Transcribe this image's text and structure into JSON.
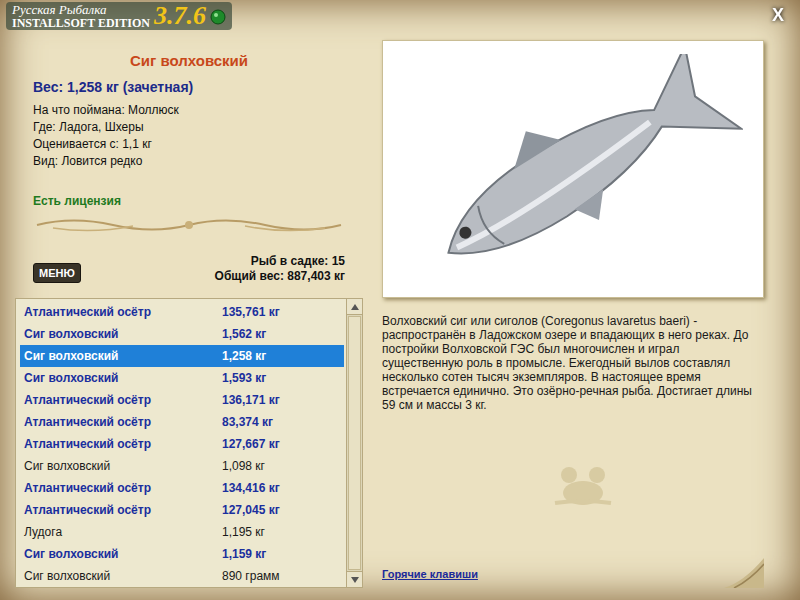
{
  "window": {
    "logo_title": "Русская Рыбалка",
    "logo_edition": "INSTALLSOFT EDITION",
    "logo_version": "3.7.6",
    "close": "X"
  },
  "fish": {
    "name": "Сиг волховский",
    "weight": "Вес: 1,258 кг (зачетная)",
    "details": [
      "На что поймана: Моллюск",
      "Где: Ладога, Шхеры",
      "Оценивается с: 1,1 кг",
      "Вид: Ловится редко"
    ],
    "license": "Есть лицензия"
  },
  "cage": {
    "count": "Рыб в садке: 15",
    "total": "Общий вес: 887,403 кг"
  },
  "menu_button": "МЕНЮ",
  "catch_list": [
    {
      "name": "Атлантический осётр",
      "weight": "135,761 кг",
      "counted": true,
      "selected": false
    },
    {
      "name": "Сиг волховский",
      "weight": "1,562 кг",
      "counted": true,
      "selected": false
    },
    {
      "name": "Сиг волховский",
      "weight": "1,258 кг",
      "counted": true,
      "selected": true
    },
    {
      "name": "Сиг волховский",
      "weight": "1,593 кг",
      "counted": true,
      "selected": false
    },
    {
      "name": "Атлантический осётр",
      "weight": "136,171 кг",
      "counted": true,
      "selected": false
    },
    {
      "name": "Атлантический осётр",
      "weight": "83,374 кг",
      "counted": true,
      "selected": false
    },
    {
      "name": "Атлантический осётр",
      "weight": "127,667 кг",
      "counted": true,
      "selected": false
    },
    {
      "name": "Сиг волховский",
      "weight": "1,098 кг",
      "counted": false,
      "selected": false
    },
    {
      "name": "Атлантический осётр",
      "weight": "134,416 кг",
      "counted": true,
      "selected": false
    },
    {
      "name": "Атлантический осётр",
      "weight": "127,045 кг",
      "counted": true,
      "selected": false
    },
    {
      "name": "Лудога",
      "weight": "1,195 кг",
      "counted": false,
      "selected": false
    },
    {
      "name": "Сиг волховский",
      "weight": "1,159 кг",
      "counted": true,
      "selected": false
    },
    {
      "name": "Сиг волховский",
      "weight": "890 грамм",
      "counted": false,
      "selected": false
    }
  ],
  "description": "Волховский сиг или сиголов (Coregonus lavaretus baeri) - распространён в Ладожском озере и впадающих в него реках. До постройки Волховской ГЭС был многочислен и играл существенную роль в промысле. Ежегодный вылов составлял несколько сотен тысяч экземпляров. В настоящее время встречается единично. Это озёрно-речная рыба. Достигает длины 59 см и массы 3 кг.",
  "hotkeys_link": "Горячие клавиши"
}
